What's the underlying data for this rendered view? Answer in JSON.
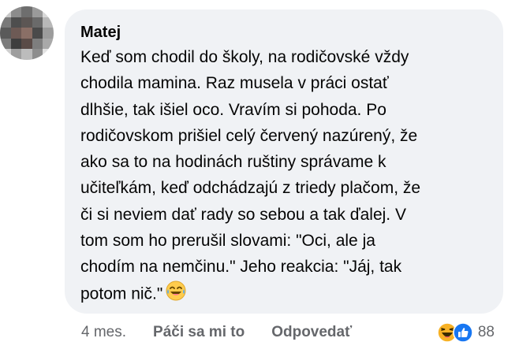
{
  "comment": {
    "author": "Matej",
    "lines": [
      "Keď som chodil do školy, na rodičovské vždy",
      "chodila mamina. Raz musela v práci ostať",
      "dlhšie, tak išiel oco. Vravím si pohoda. Po",
      "rodičovskom prišiel celý červený nazúrený, že",
      "ako sa to na hodinách ruštiny správame k",
      "učiteľkám, keď odchádzajú z triedy plačom, že",
      "či si neviem dať rady so sebou a tak ďalej. V",
      "tom som ho prerušil slovami: \"Oci, ale ja",
      "chodím na nemčinu.\" Jeho reakcia: \"Jáj, tak",
      "potom nič.\""
    ],
    "trailing_emoji": "laughing-tears-emoji"
  },
  "actions": {
    "timestamp": "4 mes.",
    "like_label": "Páči sa mi to",
    "reply_label": "Odpovedať",
    "reaction_icons": [
      "haha-reaction-icon",
      "like-reaction-icon"
    ],
    "reaction_count": "88"
  },
  "colors": {
    "bubble": "#f0f2f5",
    "text": "#050505",
    "secondary": "#65676b",
    "like_blue": "#1877f2",
    "haha_yellow": "#f7b125"
  }
}
